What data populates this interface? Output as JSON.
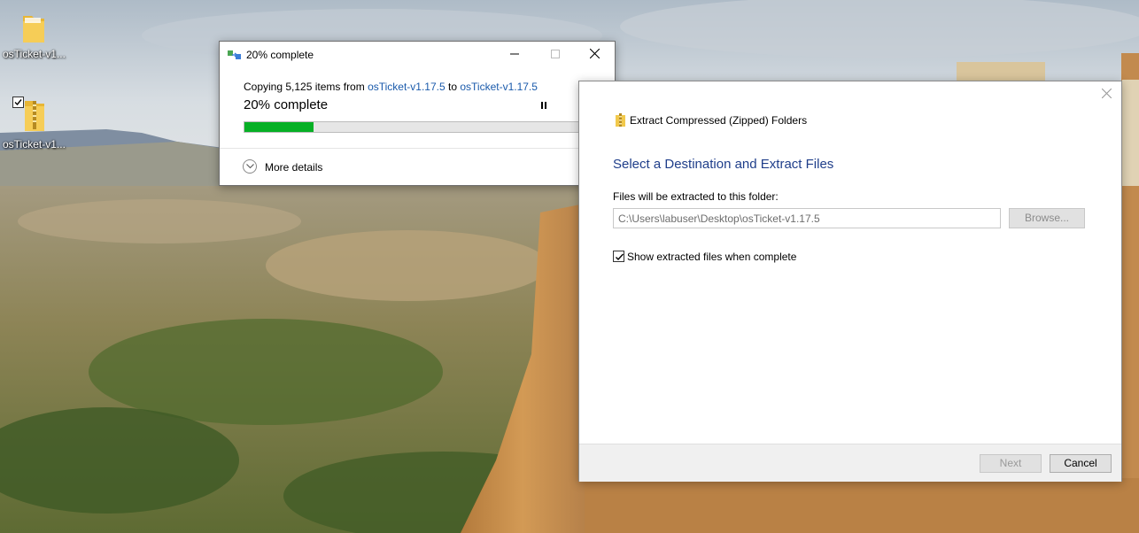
{
  "desktop": {
    "icons": [
      {
        "label": "osTicket-v1...",
        "icon": "folder-icon"
      },
      {
        "label": "osTicket-v1...",
        "icon": "zip-folder-icon",
        "selected_checkbox": true
      }
    ]
  },
  "copy_dialog": {
    "title": "20% complete",
    "desc_prefix": "Copying 5,125 items from ",
    "source": "osTicket-v1.17.5",
    "desc_mid": " to ",
    "destination": "osTicket-v1.17.5",
    "percent_text": "20% complete",
    "progress": 0.2,
    "more_details": "More details",
    "colors": {
      "progress": "#06b025",
      "link": "#1a5aab"
    }
  },
  "extract_dialog": {
    "title": "Extract Compressed (Zipped) Folders",
    "heading": "Select a Destination and Extract Files",
    "field_label": "Files will be extracted to this folder:",
    "path_value": "C:\\Users\\labuser\\Desktop\\osTicket-v1.17.5",
    "browse_label": "Browse...",
    "show_files_label": "Show extracted files when complete",
    "show_files_checked": true,
    "next_label": "Next",
    "cancel_label": "Cancel",
    "colors": {
      "heading": "#1f3e8a"
    }
  }
}
